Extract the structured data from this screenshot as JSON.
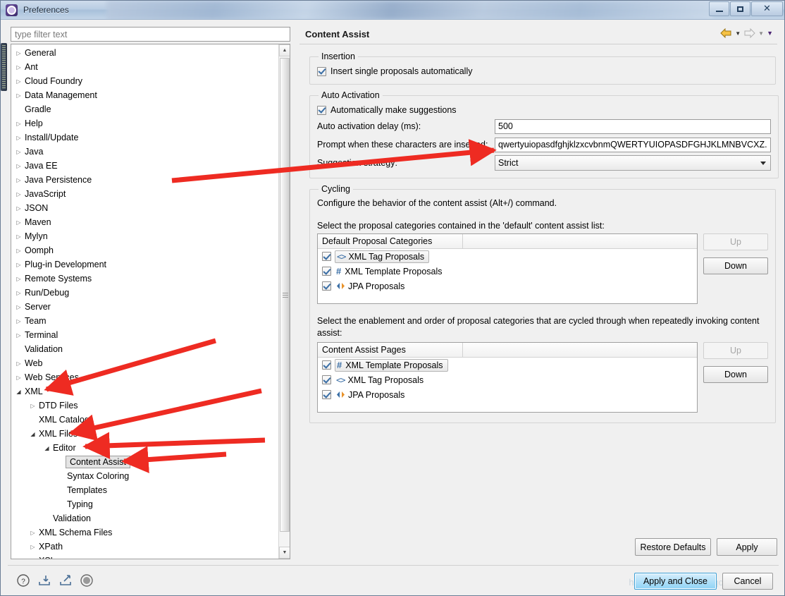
{
  "window": {
    "title": "Preferences",
    "icon": "preferences-gear-icon",
    "controls": {
      "minimize": "minimize-icon",
      "maximize": "maximize-icon",
      "close": "close-icon"
    }
  },
  "filter": {
    "placeholder": "type filter text",
    "value": ""
  },
  "tree": {
    "items": [
      {
        "label": "General",
        "indent": 0,
        "twisty": "collapsed"
      },
      {
        "label": "Ant",
        "indent": 0,
        "twisty": "collapsed"
      },
      {
        "label": "Cloud Foundry",
        "indent": 0,
        "twisty": "collapsed"
      },
      {
        "label": "Data Management",
        "indent": 0,
        "twisty": "collapsed"
      },
      {
        "label": "Gradle",
        "indent": 0,
        "twisty": "none"
      },
      {
        "label": "Help",
        "indent": 0,
        "twisty": "collapsed"
      },
      {
        "label": "Install/Update",
        "indent": 0,
        "twisty": "collapsed"
      },
      {
        "label": "Java",
        "indent": 0,
        "twisty": "collapsed"
      },
      {
        "label": "Java EE",
        "indent": 0,
        "twisty": "collapsed"
      },
      {
        "label": "Java Persistence",
        "indent": 0,
        "twisty": "collapsed"
      },
      {
        "label": "JavaScript",
        "indent": 0,
        "twisty": "collapsed"
      },
      {
        "label": "JSON",
        "indent": 0,
        "twisty": "collapsed"
      },
      {
        "label": "Maven",
        "indent": 0,
        "twisty": "collapsed"
      },
      {
        "label": "Mylyn",
        "indent": 0,
        "twisty": "collapsed"
      },
      {
        "label": "Oomph",
        "indent": 0,
        "twisty": "collapsed"
      },
      {
        "label": "Plug-in Development",
        "indent": 0,
        "twisty": "collapsed"
      },
      {
        "label": "Remote Systems",
        "indent": 0,
        "twisty": "collapsed"
      },
      {
        "label": "Run/Debug",
        "indent": 0,
        "twisty": "collapsed"
      },
      {
        "label": "Server",
        "indent": 0,
        "twisty": "collapsed"
      },
      {
        "label": "Team",
        "indent": 0,
        "twisty": "collapsed"
      },
      {
        "label": "Terminal",
        "indent": 0,
        "twisty": "collapsed"
      },
      {
        "label": "Validation",
        "indent": 0,
        "twisty": "none"
      },
      {
        "label": "Web",
        "indent": 0,
        "twisty": "collapsed"
      },
      {
        "label": "Web Services",
        "indent": 0,
        "twisty": "collapsed"
      },
      {
        "label": "XML",
        "indent": 0,
        "twisty": "expanded"
      },
      {
        "label": "DTD Files",
        "indent": 1,
        "twisty": "collapsed"
      },
      {
        "label": "XML Catalog",
        "indent": 1,
        "twisty": "none"
      },
      {
        "label": "XML Files",
        "indent": 1,
        "twisty": "expanded"
      },
      {
        "label": "Editor",
        "indent": 2,
        "twisty": "expanded"
      },
      {
        "label": "Content Assist",
        "indent": 3,
        "twisty": "none",
        "selected": true
      },
      {
        "label": "Syntax Coloring",
        "indent": 3,
        "twisty": "none"
      },
      {
        "label": "Templates",
        "indent": 3,
        "twisty": "none"
      },
      {
        "label": "Typing",
        "indent": 3,
        "twisty": "none"
      },
      {
        "label": "Validation",
        "indent": 2,
        "twisty": "none"
      },
      {
        "label": "XML Schema Files",
        "indent": 1,
        "twisty": "collapsed"
      },
      {
        "label": "XPath",
        "indent": 1,
        "twisty": "collapsed"
      },
      {
        "label": "XSL",
        "indent": 1,
        "twisty": "collapsed"
      }
    ]
  },
  "page": {
    "title": "Content Assist",
    "nav": {
      "back": "back-arrow-icon",
      "forward": "forward-arrow-icon",
      "menu": "dropdown-menu-icon"
    },
    "insertion": {
      "legend": "Insertion",
      "insert_single_label": "Insert single proposals automatically",
      "insert_single_checked": true
    },
    "auto_activation": {
      "legend": "Auto Activation",
      "auto_suggest_label": "Automatically make suggestions",
      "auto_suggest_checked": true,
      "delay_label": "Auto activation delay (ms):",
      "delay_value": "500",
      "chars_label": "Prompt when these characters are inserted:",
      "chars_value": "qwertyuiopasdfghjklzxcvbnmQWERTYUIOPASDFGHJKLMNBVCXZ.",
      "strategy_label": "Suggestion strategy:",
      "strategy_value": "Strict"
    },
    "cycling": {
      "legend": "Cycling",
      "description": "Configure the behavior of the content assist (Alt+/) command.",
      "default_prompt": "Select the proposal categories contained in the 'default' content assist list:",
      "default_table": {
        "columns": [
          "Default Proposal Categories",
          ""
        ],
        "rows": [
          {
            "checked": true,
            "icon": "xml-tag-icon",
            "label": "XML Tag Proposals",
            "selected": true
          },
          {
            "checked": true,
            "icon": "xml-template-icon",
            "label": "XML Template Proposals",
            "selected": false
          },
          {
            "checked": true,
            "icon": "jpa-icon",
            "label": "JPA Proposals",
            "selected": false
          }
        ],
        "up_label": "Up",
        "down_label": "Down",
        "up_disabled": true
      },
      "cycle_prompt": "Select the enablement and order of proposal categories that are cycled through when repeatedly invoking content assist:",
      "cycle_table": {
        "columns": [
          "Content Assist Pages",
          ""
        ],
        "rows": [
          {
            "checked": true,
            "icon": "xml-template-icon",
            "label": "XML Template Proposals",
            "selected": true
          },
          {
            "checked": true,
            "icon": "xml-tag-icon",
            "label": "XML Tag Proposals",
            "selected": false
          },
          {
            "checked": true,
            "icon": "jpa-icon",
            "label": "JPA Proposals",
            "selected": false
          }
        ],
        "up_label": "Up",
        "down_label": "Down",
        "up_disabled": true
      }
    },
    "restore_defaults_label": "Restore Defaults",
    "apply_label": "Apply"
  },
  "bottom": {
    "icons": [
      "help-icon",
      "import-icon",
      "export-icon",
      "record-icon"
    ],
    "apply_close_label": "Apply and Close",
    "cancel_label": "Cancel",
    "watermark": "http://blog.csdn.net/qq_40161886"
  },
  "colors": {
    "accent": "#3a6ea5",
    "annotation_red": "#ee2b22",
    "primary_button": "#8fd3f5"
  }
}
